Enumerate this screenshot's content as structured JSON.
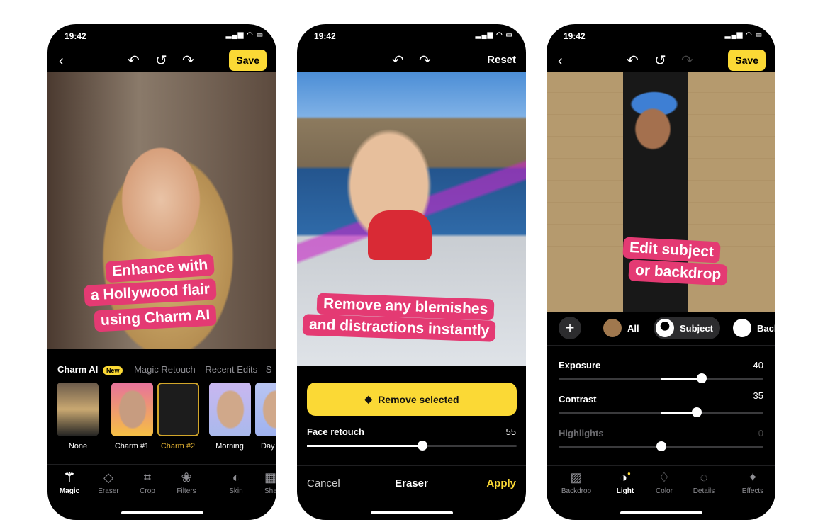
{
  "status_time": "19:42",
  "phone1": {
    "callout": [
      "Enhance with",
      "a Hollywood flair",
      "using Charm AI"
    ],
    "tabs": [
      {
        "label": "Charm AI",
        "badge": "New"
      },
      {
        "label": "Magic Retouch"
      },
      {
        "label": "Recent Edits"
      },
      {
        "label": "S"
      }
    ],
    "presets": [
      {
        "label": "None"
      },
      {
        "label": "Charm #1"
      },
      {
        "label": "Charm #2",
        "selected": true
      },
      {
        "label": "Morning"
      },
      {
        "label": "Day"
      }
    ],
    "tools": [
      {
        "label": "Magic",
        "icon": "magic-wand-icon",
        "active": true
      },
      {
        "label": "Eraser",
        "icon": "eraser-icon"
      },
      {
        "label": "Crop",
        "icon": "crop-icon"
      },
      {
        "label": "Filters",
        "icon": "filters-icon"
      },
      {
        "label": "Skin",
        "icon": "skin-icon"
      },
      {
        "label": "Sha",
        "icon": "shape-icon"
      }
    ],
    "save_label": "Save"
  },
  "phone2": {
    "reset_label": "Reset",
    "callout": [
      "Remove any blemishes",
      "and distractions instantly"
    ],
    "remove_button": "Remove selected",
    "slider": {
      "label": "Face retouch",
      "value": 55,
      "min": 0,
      "max": 100
    },
    "cancel": "Cancel",
    "title": "Eraser",
    "apply": "Apply"
  },
  "phone3": {
    "save_label": "Save",
    "callout": [
      "Edit subject",
      "or backdrop"
    ],
    "chips": [
      {
        "label": "All"
      },
      {
        "label": "Subject",
        "selected": true
      },
      {
        "label": "Back"
      }
    ],
    "sliders": [
      {
        "label": "Exposure",
        "value": 40,
        "min": -100,
        "max": 100
      },
      {
        "label": "Contrast",
        "value": 35,
        "min": -100,
        "max": 100
      },
      {
        "label": "Highlights",
        "value": 0,
        "min": -100,
        "max": 100,
        "dim": true
      }
    ],
    "tools": [
      {
        "label": "Backdrop",
        "icon": "image-icon"
      },
      {
        "label": "Light",
        "icon": "contrast-icon",
        "active": true
      },
      {
        "label": "Color",
        "icon": "drop-icon"
      },
      {
        "label": "Details",
        "icon": "details-icon"
      },
      {
        "label": "Effects",
        "icon": "sparkle-icon"
      }
    ]
  },
  "colors": {
    "accent": "#fbd935",
    "callout": "#e43a73"
  }
}
